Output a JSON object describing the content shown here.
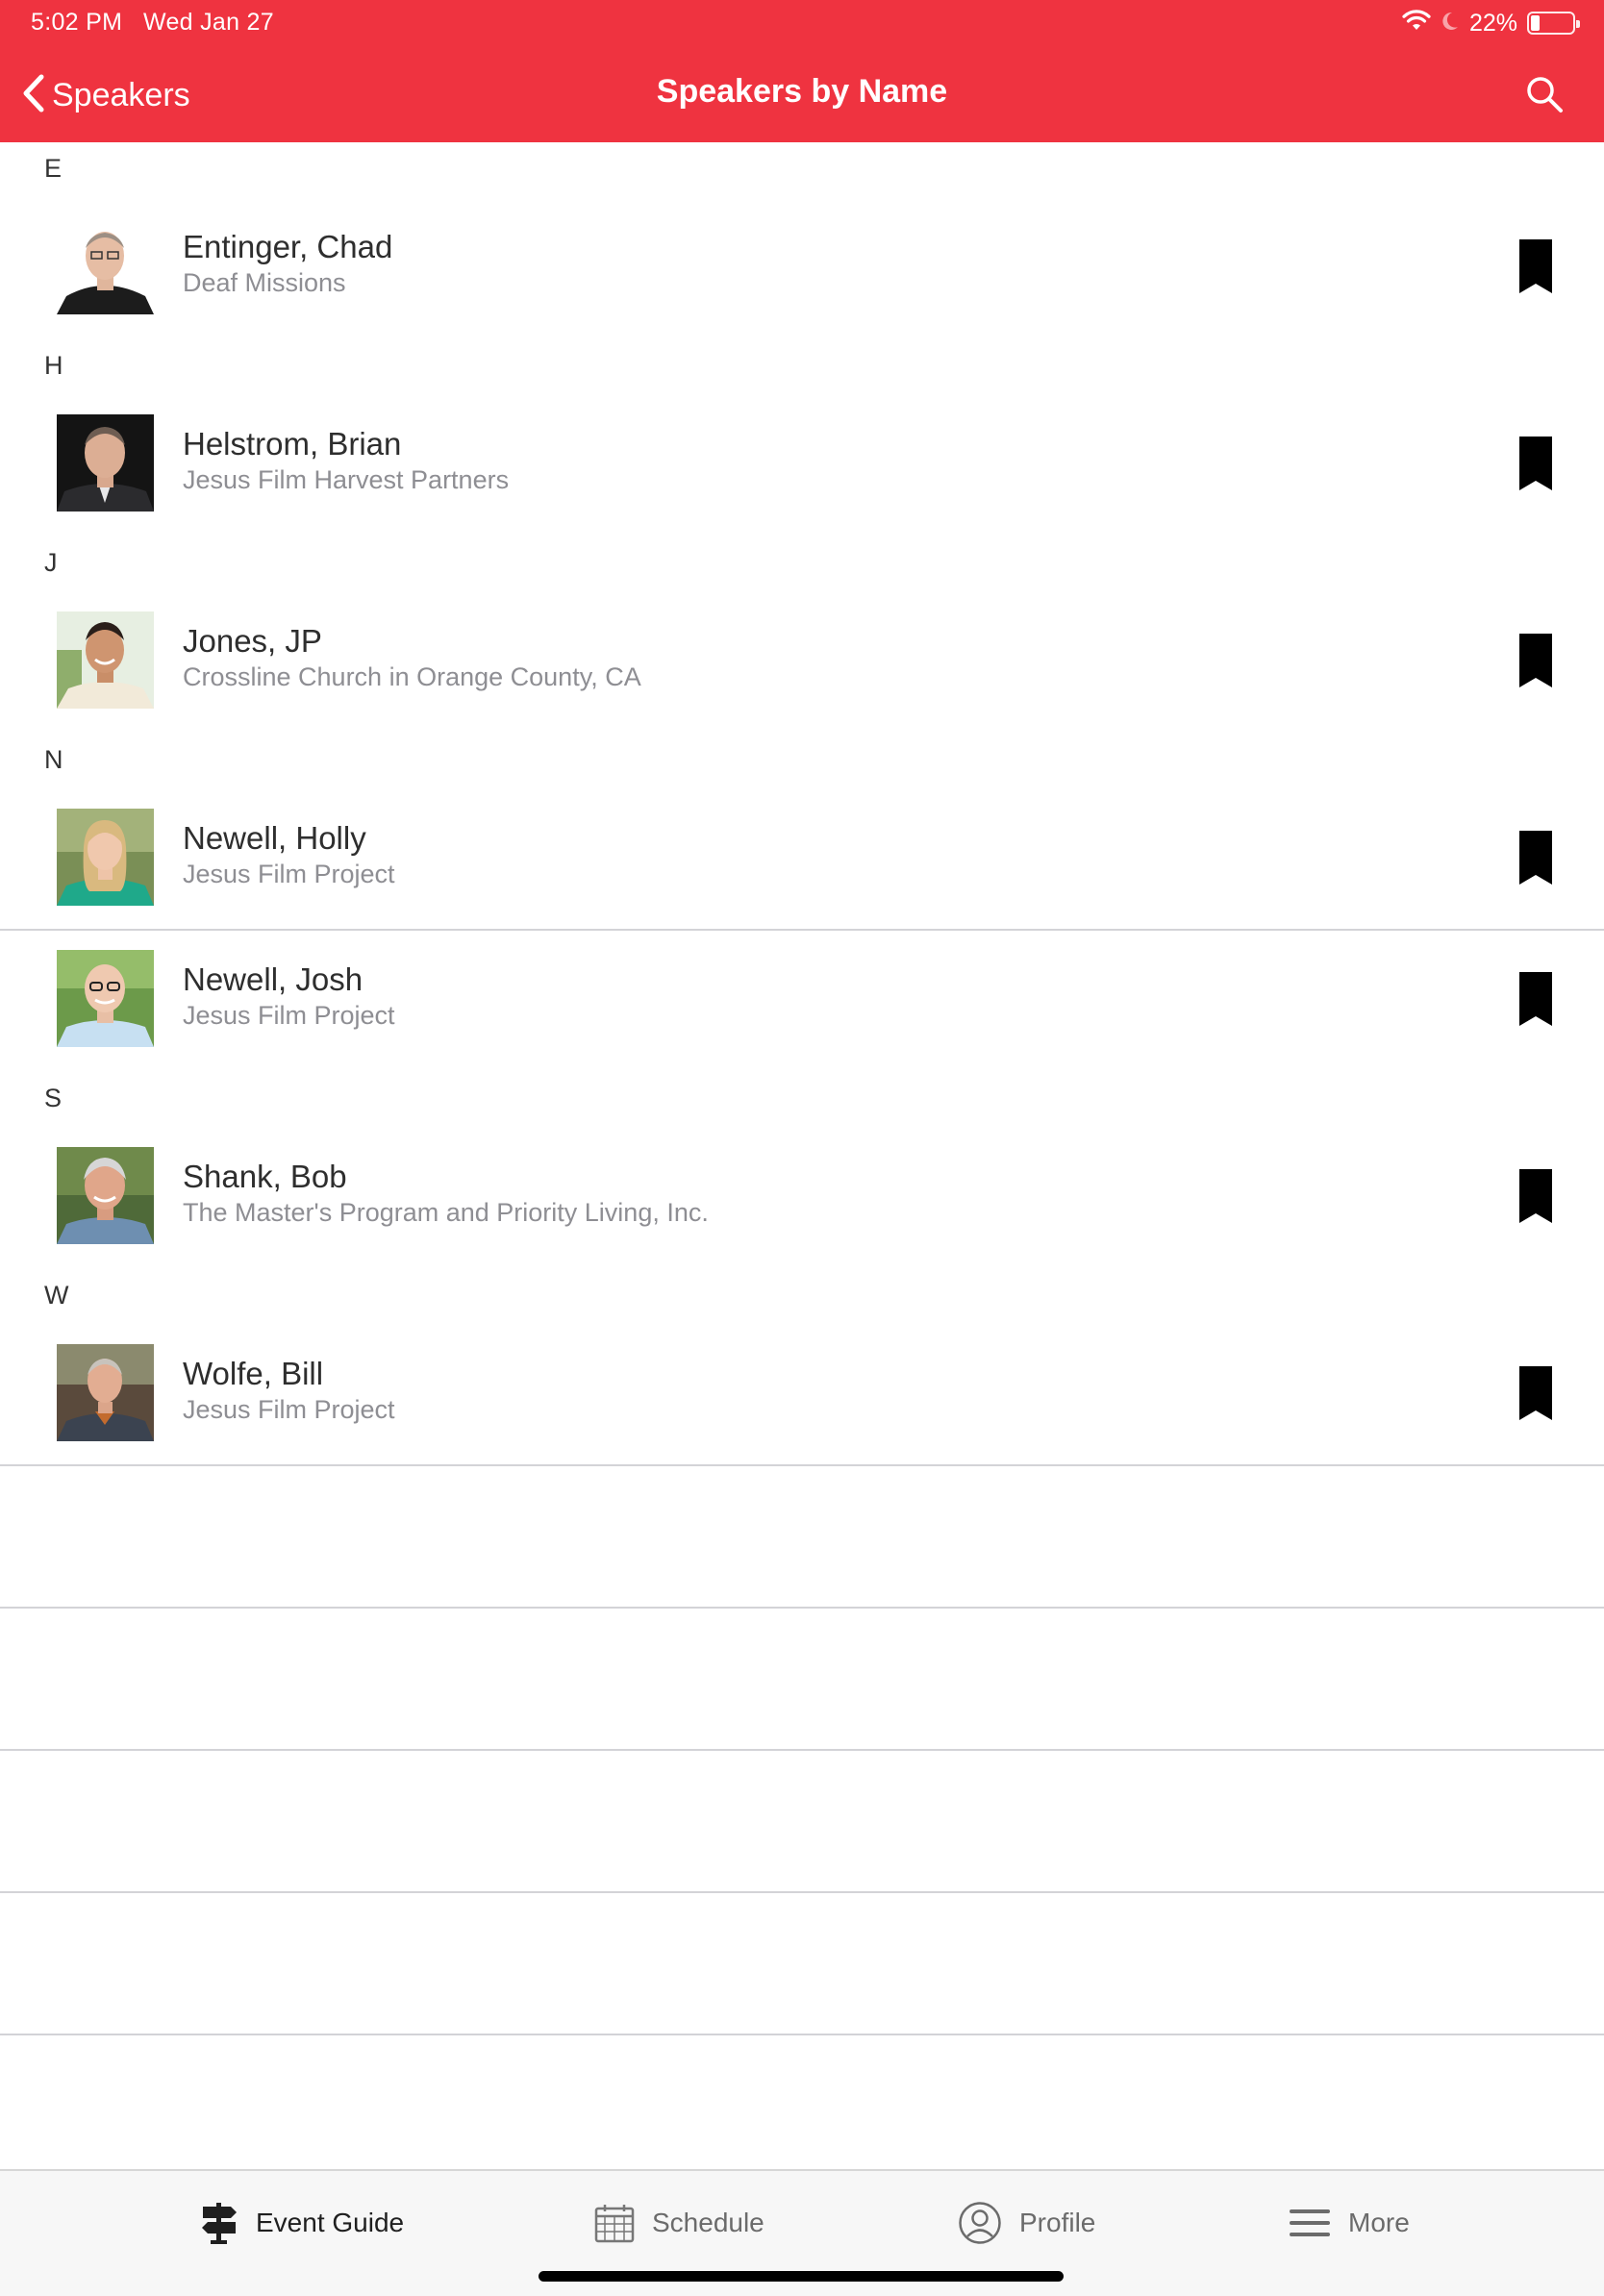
{
  "status_bar": {
    "time": "5:02 PM",
    "date": "Wed Jan 27",
    "battery_percent": "22%",
    "battery_level": 0.22,
    "icons": [
      "wifi-icon",
      "moon-icon",
      "battery-icon"
    ]
  },
  "nav": {
    "back_label": "Speakers",
    "title": "Speakers by Name",
    "search_icon": "search-icon"
  },
  "colors": {
    "brand": "#ef3340",
    "secondary_text": "#8e8e93",
    "divider": "#d3d3d7",
    "bookmark": "#000000"
  },
  "sections": [
    {
      "letter": "E",
      "speakers": [
        {
          "name": "Entinger, Chad",
          "org": "Deaf Missions",
          "bookmarked": false
        }
      ]
    },
    {
      "letter": "H",
      "speakers": [
        {
          "name": "Helstrom, Brian",
          "org": "Jesus Film Harvest Partners",
          "bookmarked": false
        }
      ]
    },
    {
      "letter": "J",
      "speakers": [
        {
          "name": "Jones, JP",
          "org": "Crossline Church in Orange County, CA",
          "bookmarked": false
        }
      ]
    },
    {
      "letter": "N",
      "speakers": [
        {
          "name": "Newell, Holly",
          "org": "Jesus Film Project",
          "bookmarked": false
        },
        {
          "name": "Newell, Josh",
          "org": "Jesus Film Project",
          "bookmarked": false
        }
      ]
    },
    {
      "letter": "S",
      "speakers": [
        {
          "name": "Shank, Bob",
          "org": "The Master's Program and Priority Living, Inc.",
          "bookmarked": false
        }
      ]
    },
    {
      "letter": "W",
      "speakers": [
        {
          "name": "Wolfe, Bill",
          "org": "Jesus Film Project",
          "bookmarked": false
        }
      ]
    }
  ],
  "tab_bar": {
    "tabs": [
      {
        "label": "Event Guide",
        "icon": "signpost-icon",
        "active": true
      },
      {
        "label": "Schedule",
        "icon": "calendar-icon",
        "active": false
      },
      {
        "label": "Profile",
        "icon": "profile-icon",
        "active": false
      },
      {
        "label": "More",
        "icon": "menu-icon",
        "active": false
      }
    ]
  }
}
